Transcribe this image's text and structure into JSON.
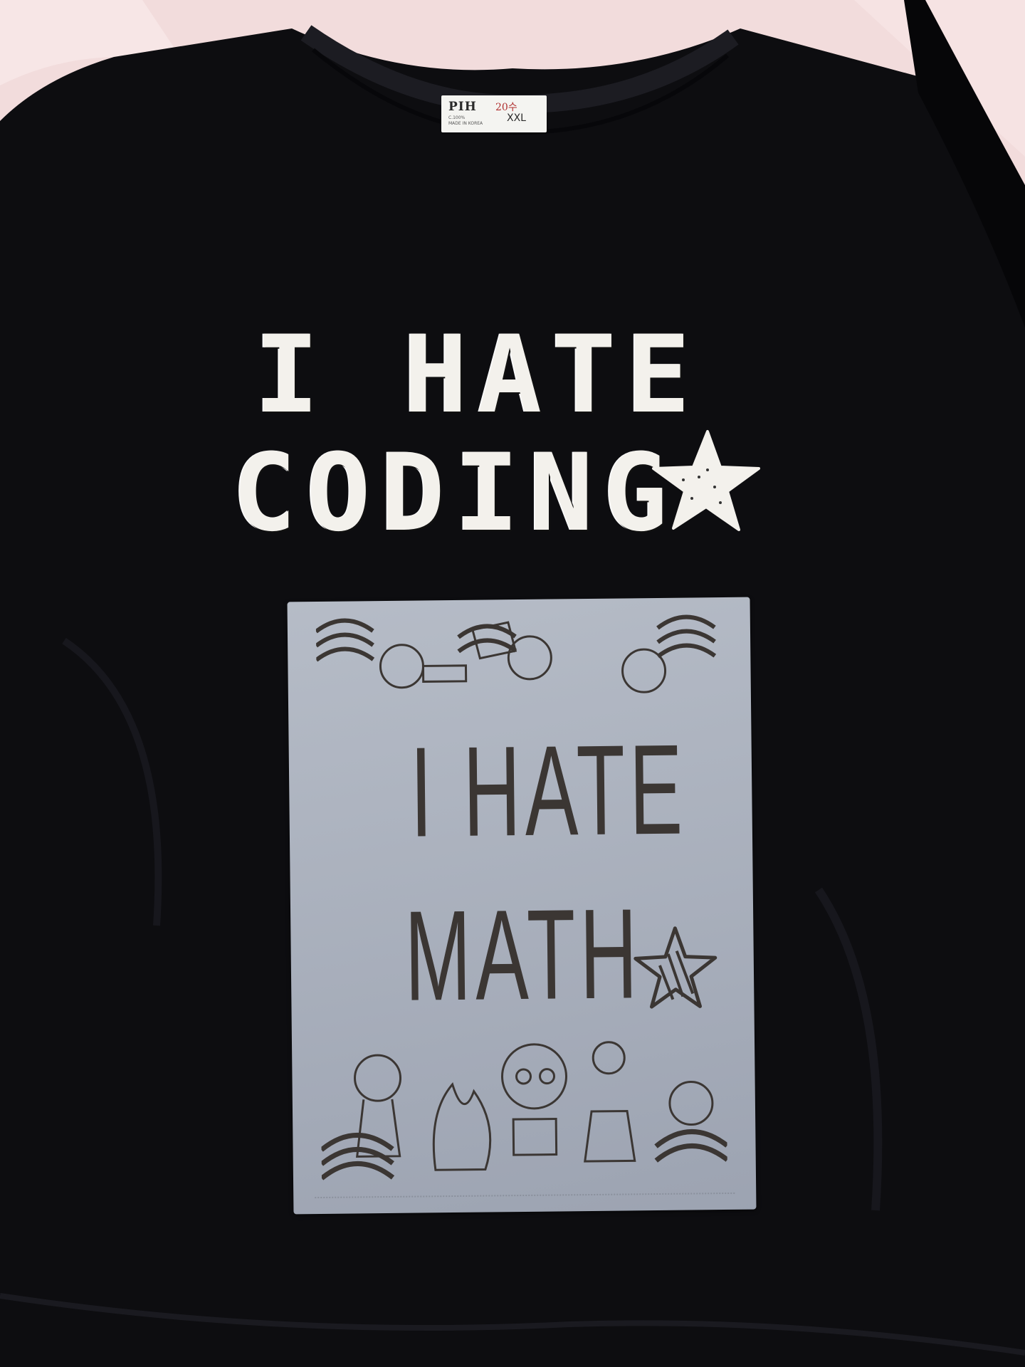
{
  "shirt": {
    "color": "#0d0d10",
    "label_tag": {
      "brand": "PIH",
      "number": "20수",
      "size": "XXL",
      "fine_print": "C.100%\nMADE IN KOREA"
    },
    "print_lines": [
      "I HATE",
      "CODING"
    ],
    "print_color": "#f3f1ec",
    "icons": [
      "star-icon"
    ]
  },
  "folder": {
    "color": "#c9d0dc",
    "print_lines": [
      "I HATE",
      "MATH"
    ],
    "print_color": "#3b3633",
    "icons": [
      "star-icon",
      "cartoon-girl-icon",
      "wave-pattern-icon",
      "flame-icon"
    ]
  },
  "background": {
    "color": "#f2dcdc"
  }
}
